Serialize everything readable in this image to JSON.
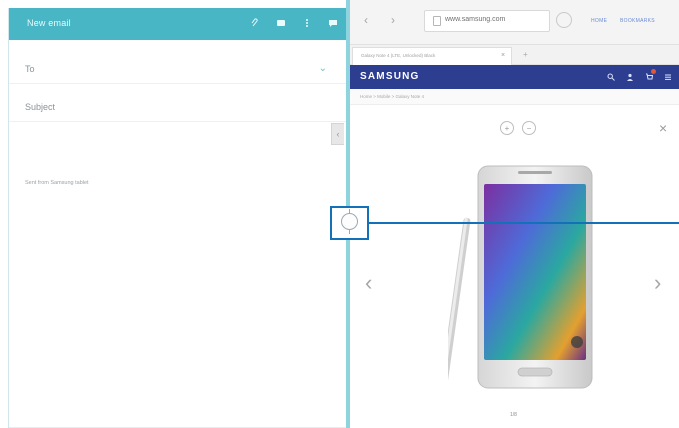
{
  "email": {
    "title": "New email",
    "toolbar_icons": [
      "attach-icon",
      "contacts-icon",
      "more-icon",
      "send-icon"
    ],
    "to_label": "To",
    "subject_label": "Subject",
    "signature": "Sent from Samsung tablet"
  },
  "browser": {
    "url": "www.samsung.com",
    "home_label": "HOME",
    "bookmarks_label": "BOOKMARKS",
    "tab_title": "Galaxy Note 4 (LTE, Unlocked) Black",
    "site_logo": "SAMSUNG",
    "breadcrumbs": "Home > Mobile > Galaxy Note 4",
    "pager": "1/8"
  },
  "colors": {
    "email_bar": "#49b6c6",
    "divider": "#8ed4df",
    "site_header": "#2d3d8f",
    "callout": "#1471b7"
  }
}
